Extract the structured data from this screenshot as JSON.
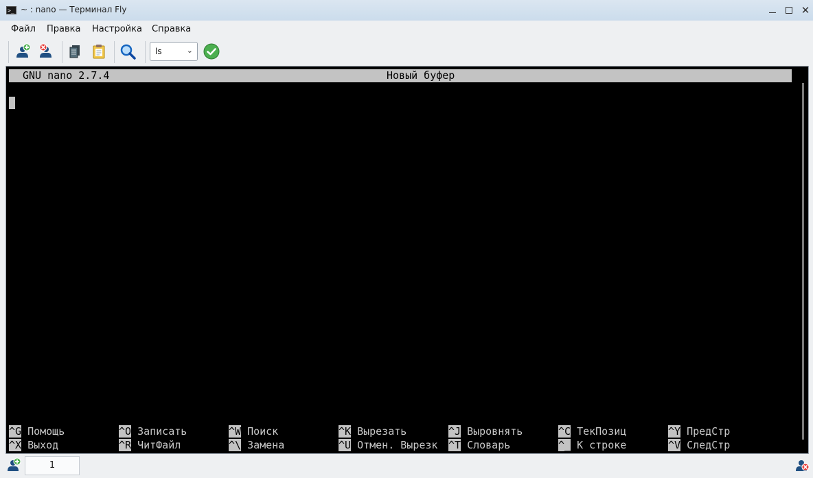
{
  "window": {
    "title": "~ : nano — Терминал Fly",
    "app_icon_glyph": ">_"
  },
  "menu": {
    "items": [
      "Файл",
      "Правка",
      "Настройка",
      "Справка"
    ]
  },
  "toolbar": {
    "icons": [
      "new-tab-icon",
      "close-tab-icon",
      "copy-icon",
      "paste-icon",
      "search-icon",
      "execute-icon"
    ],
    "command_select_value": "ls"
  },
  "terminal": {
    "header_version": "GNU nano 2.7.4",
    "header_buffer": "Новый буфер",
    "shortcuts_row1": [
      {
        "key": "^G",
        "label": "Помощь"
      },
      {
        "key": "^O",
        "label": "Записать"
      },
      {
        "key": "^W",
        "label": "Поиск"
      },
      {
        "key": "^K",
        "label": "Вырезать"
      },
      {
        "key": "^J",
        "label": "Выровнять"
      },
      {
        "key": "^C",
        "label": "ТекПозиц"
      },
      {
        "key": "^Y",
        "label": "ПредСтр"
      }
    ],
    "shortcuts_row2": [
      {
        "key": "^X",
        "label": "Выход"
      },
      {
        "key": "^R",
        "label": "ЧитФайл"
      },
      {
        "key": "^\\",
        "label": "Замена"
      },
      {
        "key": "^U",
        "label": "Отмен. Вырезк"
      },
      {
        "key": "^T",
        "label": "Словарь"
      },
      {
        "key": "^_",
        "label": "К строке"
      },
      {
        "key": "^V",
        "label": "СледСтр"
      }
    ]
  },
  "tabs": {
    "active_tab_label": "1"
  },
  "colors": {
    "terminal_bg": "#000000",
    "terminal_fg": "#c8c8c8",
    "header_bg": "#c3c3c3"
  }
}
